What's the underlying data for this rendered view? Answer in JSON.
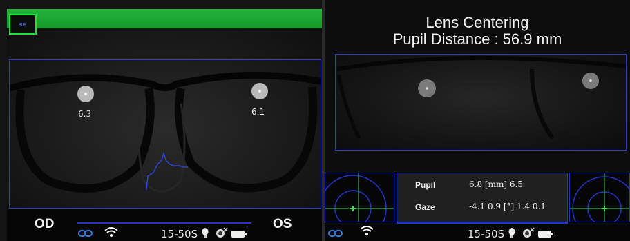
{
  "left_panel": {
    "pupil_od_value": "6.3",
    "pupil_os_value": "6.1",
    "od_label": "OD",
    "os_label": "OS",
    "status": {
      "model": "15-50S",
      "icons": [
        "link-icon",
        "wifi-icon",
        "bulb-icon",
        "camera-icon",
        "battery-icon"
      ]
    }
  },
  "right_panel": {
    "title": "Lens Centering",
    "subtitle": "Pupil Distance : 56.9 mm",
    "info": {
      "pupil_label": "Pupil",
      "pupil_values": "6.8 [mm] 6.5",
      "gaze_label": "Gaze",
      "gaze_values": "-4.1  0.9 [°] 1.4  0.1"
    },
    "status": {
      "model": "15-50S",
      "icons": [
        "link-icon",
        "wifi-icon",
        "bulb-icon",
        "camera-icon",
        "battery-icon"
      ]
    }
  },
  "colors": {
    "accent_green": "#1fbf35",
    "frame_blue": "#2a3bd0",
    "crosshair_green": "#2ecf3a",
    "marker_green": "#3ee04a"
  }
}
